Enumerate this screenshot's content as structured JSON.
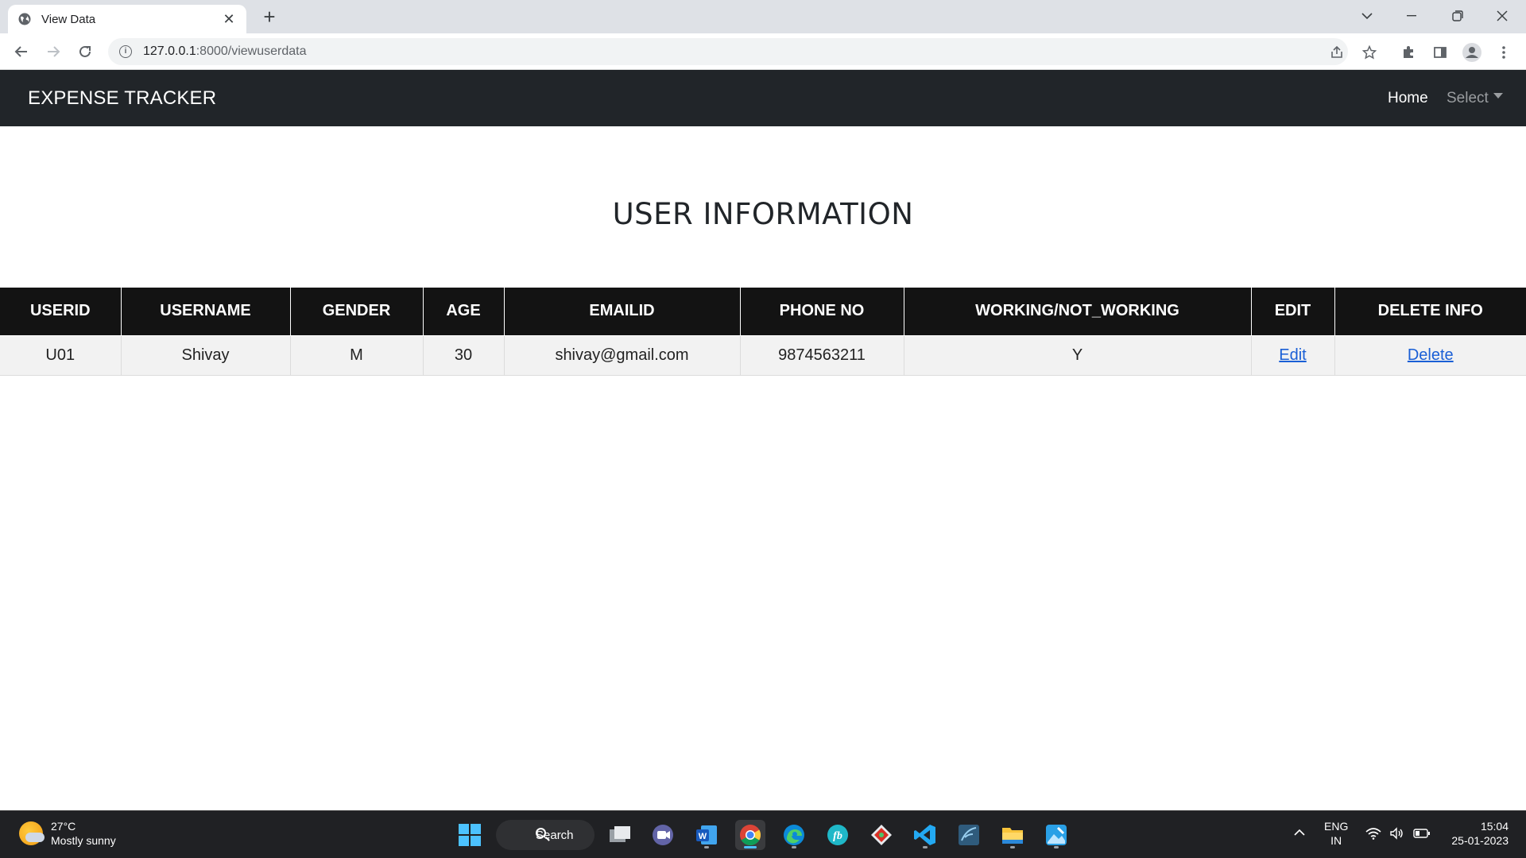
{
  "browser": {
    "tab_title": "View Data",
    "tab_close": "✕",
    "new_tab": "+",
    "url_host": "127.0.0.1",
    "url_path": ":8000/viewuserdata"
  },
  "navbar": {
    "brand": "EXPENSE TRACKER",
    "home": "Home",
    "select": "Select"
  },
  "page": {
    "title": "USER INFORMATION"
  },
  "table": {
    "headers": [
      "USERID",
      "USERNAME",
      "GENDER",
      "AGE",
      "EMAILID",
      "PHONE NO",
      "WORKING/NOT_WORKING",
      "EDIT",
      "DELETE INFO"
    ],
    "rows": [
      {
        "userid": "U01",
        "username": "Shivay",
        "gender": "M",
        "age": "30",
        "email": "shivay@gmail.com",
        "phone": "9874563211",
        "working": "Y",
        "edit": "Edit",
        "delete": "Delete"
      }
    ]
  },
  "taskbar": {
    "temperature": "27°C",
    "weather": "Mostly sunny",
    "search": "Search",
    "lang_top": "ENG",
    "lang_bottom": "IN",
    "time": "15:04",
    "date": "25-01-2023"
  },
  "colors": {
    "navbar_bg": "#212529",
    "table_header_bg": "#131313",
    "table_row_bg": "#f2f2f2",
    "link": "#1a5fd6"
  }
}
